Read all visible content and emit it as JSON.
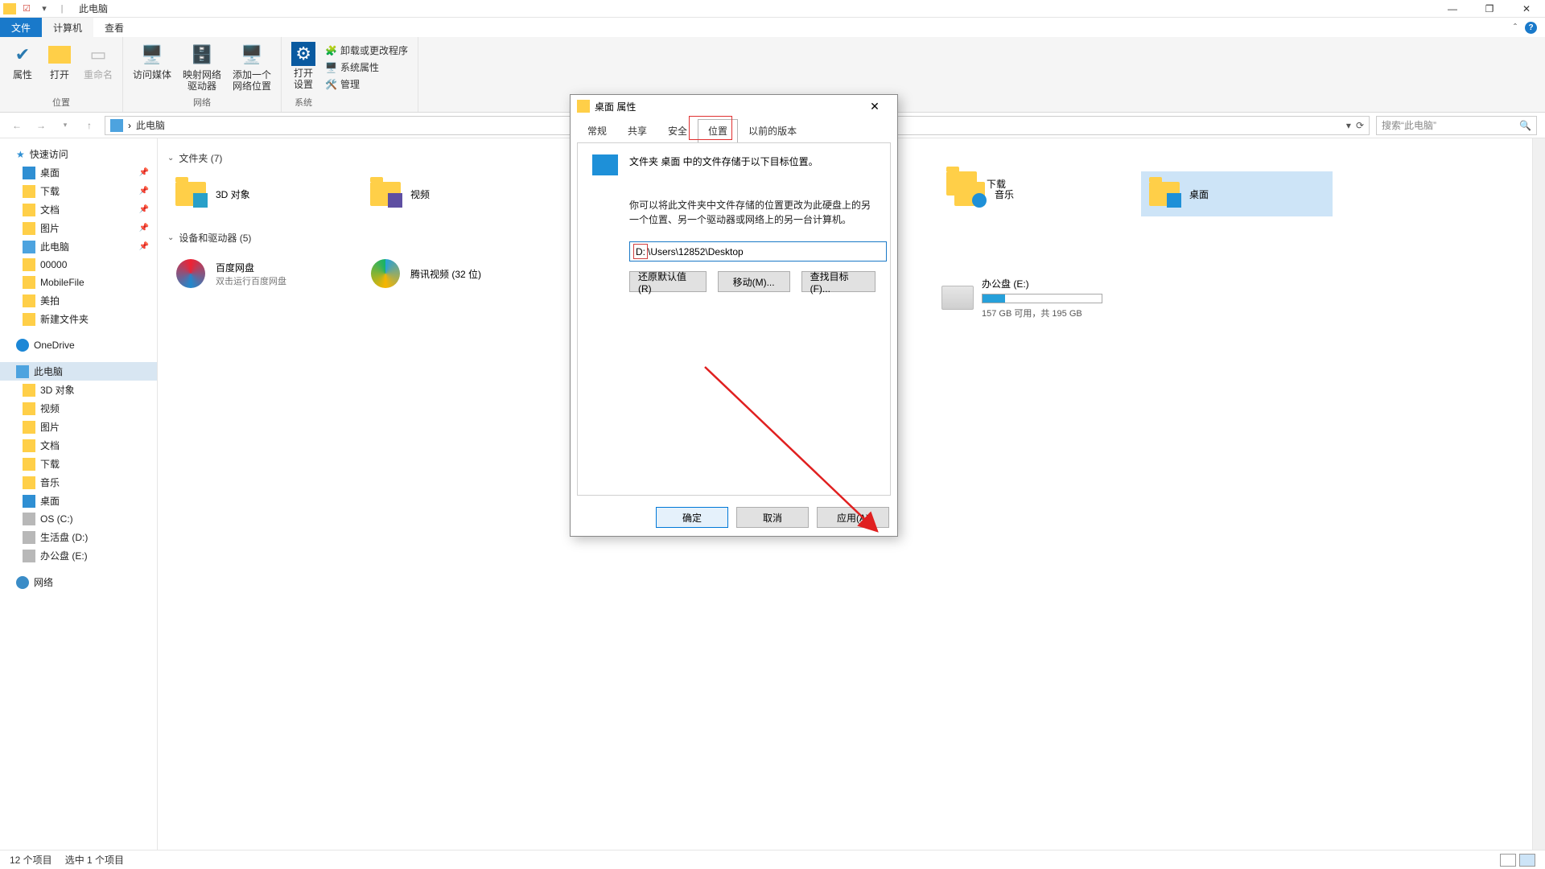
{
  "titlebar": {
    "title": "此电脑"
  },
  "window_controls": {
    "min": "—",
    "max": "❐",
    "close": "✕"
  },
  "ribbon_tabs": {
    "file": "文件",
    "computer": "计算机",
    "view": "查看"
  },
  "ribbon": {
    "group_location": {
      "properties": "属性",
      "open": "打开",
      "rename": "重命名",
      "label": "位置"
    },
    "group_network": {
      "access_media": "访问媒体",
      "map_drive": "映射网络\n驱动器",
      "add_location": "添加一个\n网络位置",
      "label": "网络"
    },
    "group_system": {
      "open_settings": "打开\n设置",
      "uninstall": "卸载或更改程序",
      "system_props": "系统属性",
      "manage": "管理",
      "label": "系统"
    }
  },
  "addressbar": {
    "crumb_sep": "›",
    "location": "此电脑"
  },
  "search": {
    "placeholder": "搜索“此电脑”"
  },
  "sidebar": {
    "quick_access": "快速访问",
    "pinned": [
      {
        "label": "桌面"
      },
      {
        "label": "下载"
      },
      {
        "label": "文档"
      },
      {
        "label": "图片"
      },
      {
        "label": "此电脑"
      },
      {
        "label": "00000"
      },
      {
        "label": "MobileFile"
      },
      {
        "label": "美拍"
      },
      {
        "label": "新建文件夹"
      }
    ],
    "onedrive": "OneDrive",
    "this_pc": "此电脑",
    "pc_children": [
      "3D 对象",
      "视频",
      "图片",
      "文档",
      "下载",
      "音乐",
      "桌面",
      "OS (C:)",
      "生活盘 (D:)",
      "办公盘 (E:)"
    ],
    "network": "网络"
  },
  "content": {
    "folders_header": "文件夹 (7)",
    "folders": [
      {
        "label": "3D 对象"
      },
      {
        "label": "视频"
      },
      {
        "label": "下载"
      },
      {
        "label": "音乐"
      },
      {
        "label": "桌面",
        "selected": true
      }
    ],
    "devices_header": "设备和驱动器 (5)",
    "devices": [
      {
        "label": "百度网盘",
        "sub": "双击运行百度网盘"
      },
      {
        "label": "腾讯视频 (32 位)"
      }
    ],
    "drive_e": {
      "label": "办公盘 (E:)",
      "usage_text": "157 GB 可用，共 195 GB",
      "used_pct": 19
    }
  },
  "statusbar": {
    "count": "12 个项目",
    "selected": "选中 1 个项目"
  },
  "dialog": {
    "title": "桌面 属性",
    "tabs": {
      "general": "常规",
      "sharing": "共享",
      "security": "安全",
      "location": "位置",
      "prev_versions": "以前的版本"
    },
    "heading": "文件夹 桌面 中的文件存储于以下目标位置。",
    "paragraph": "你可以将此文件夹中文件存储的位置更改为此硬盘上的另一个位置、另一个驱动器或网络上的另一台计算机。",
    "path_drive": "D:",
    "path_rest": "\\Users\\12852\\Desktop",
    "buttons": {
      "restore": "还原默认值(R)",
      "move": "移动(M)...",
      "find": "查找目标(F)..."
    },
    "footer": {
      "ok": "确定",
      "cancel": "取消",
      "apply": "应用(A)"
    }
  }
}
